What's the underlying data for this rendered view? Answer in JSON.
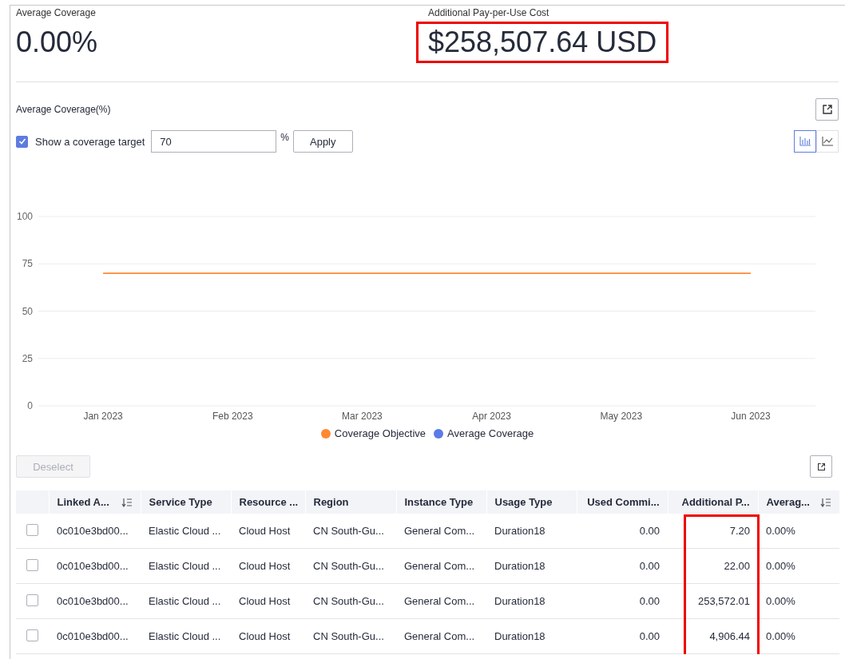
{
  "summary": [
    {
      "label": "Average Coverage",
      "value": "0.00%",
      "highlighted": false
    },
    {
      "label": "Additional Pay-per-Use Cost",
      "value": "$258,507.64 USD",
      "highlighted": true
    }
  ],
  "chart_section": {
    "title": "Average Coverage(%)",
    "target": {
      "checked": true,
      "label": "Show a coverage target",
      "value": "70",
      "unit": "%",
      "apply": "Apply"
    },
    "view_toggle": [
      {
        "kind": "bar",
        "selected": true
      },
      {
        "kind": "line",
        "selected": false
      }
    ],
    "chart_data": {
      "type": "line",
      "categories": [
        "Jan 2023",
        "Feb 2023",
        "Mar 2023",
        "Apr 2023",
        "May 2023",
        "Jun 2023"
      ],
      "ylim": [
        0,
        100
      ],
      "yticks": [
        0,
        25,
        50,
        75,
        100
      ],
      "grid": true,
      "series": [
        {
          "name": "Coverage Objective",
          "color": "#ff8833",
          "values": [
            70,
            70,
            70,
            70,
            70,
            70
          ]
        },
        {
          "name": "Average Coverage",
          "color": "#5b7be6",
          "values": [
            null,
            null,
            null,
            null,
            null,
            null
          ]
        }
      ]
    }
  },
  "table": {
    "deselect": "Deselect",
    "columns": [
      {
        "label": "Linked A...",
        "sortable": true,
        "highlighted": false
      },
      {
        "label": "Service Type",
        "sortable": false,
        "highlighted": false
      },
      {
        "label": "Resource ...",
        "sortable": false,
        "highlighted": false
      },
      {
        "label": "Region",
        "sortable": false,
        "highlighted": false
      },
      {
        "label": "Instance Type",
        "sortable": false,
        "highlighted": false
      },
      {
        "label": "Usage Type",
        "sortable": false,
        "highlighted": false
      },
      {
        "label": "Used Commi...",
        "sortable": false,
        "highlighted": false
      },
      {
        "label": "Additional P...",
        "sortable": false,
        "highlighted": true
      },
      {
        "label": "Averag...",
        "sortable": true,
        "highlighted": false
      }
    ],
    "rows": [
      {
        "checked": false,
        "cells": [
          "0c010e3bd00...",
          "Elastic Cloud ...",
          "Cloud Host",
          "CN South-Gu...",
          "General Com...",
          "Duration18",
          "0.00",
          "7.20",
          "0.00%"
        ]
      },
      {
        "checked": false,
        "cells": [
          "0c010e3bd00...",
          "Elastic Cloud ...",
          "Cloud Host",
          "CN South-Gu...",
          "General Com...",
          "Duration18",
          "0.00",
          "22.00",
          "0.00%"
        ]
      },
      {
        "checked": false,
        "cells": [
          "0c010e3bd00...",
          "Elastic Cloud ...",
          "Cloud Host",
          "CN South-Gu...",
          "General Com...",
          "Duration18",
          "0.00",
          "253,572.01",
          "0.00%"
        ]
      },
      {
        "checked": false,
        "cells": [
          "0c010e3bd00...",
          "Elastic Cloud ...",
          "Cloud Host",
          "CN South-Gu...",
          "General Com...",
          "Duration18",
          "0.00",
          "4,906.44",
          "0.00%"
        ]
      }
    ]
  }
}
